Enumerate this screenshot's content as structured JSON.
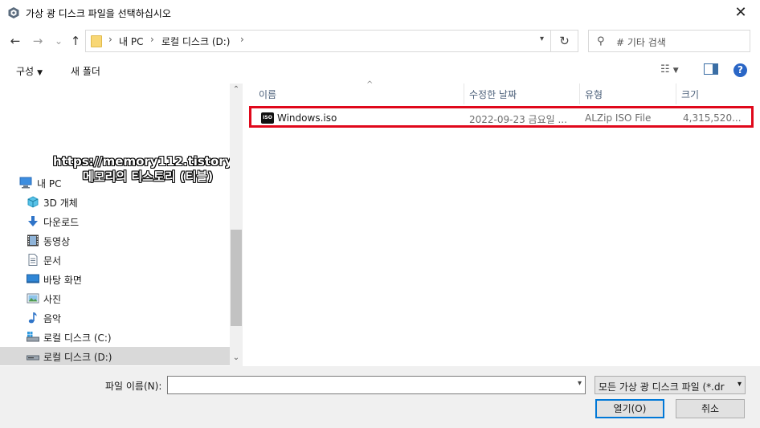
{
  "window": {
    "title": "가상 광 디스크 파일을 선택하십시오",
    "app_icon": "vmware-logo-icon",
    "close_glyph": "✕"
  },
  "nav": {
    "back_glyph": "←",
    "forward_glyph": "→",
    "recent_glyph": "⌄",
    "up_glyph": "↑",
    "breadcrumb": [
      "내 PC",
      "로컬 디스크 (D:)"
    ],
    "separator": "›",
    "refresh_glyph": "↻",
    "search_placeholder": "# 기타 검색"
  },
  "toolbar": {
    "organize_label": "구성",
    "new_folder_label": "새 폴더"
  },
  "watermark": {
    "line1": "https://memory112.tistory.com",
    "line2": "메모리의 티스토리 (티블)"
  },
  "sidebar": {
    "items": [
      {
        "label": "내 PC",
        "icon": "computer-icon"
      },
      {
        "label": "3D 개체",
        "icon": "cube-3d-icon"
      },
      {
        "label": "다운로드",
        "icon": "download-arrow-icon"
      },
      {
        "label": "동영상",
        "icon": "film-icon"
      },
      {
        "label": "문서",
        "icon": "document-icon"
      },
      {
        "label": "바탕 화면",
        "icon": "desktop-icon"
      },
      {
        "label": "사진",
        "icon": "picture-icon"
      },
      {
        "label": "음악",
        "icon": "music-note-icon"
      },
      {
        "label": "로컬 디스크 (C:)",
        "icon": "windows-drive-icon"
      },
      {
        "label": "로컬 디스크 (D:)",
        "icon": "drive-icon",
        "selected": true
      }
    ]
  },
  "columns": {
    "name": "이름",
    "date": "수정한 날짜",
    "type": "유형",
    "size": "크기"
  },
  "files": [
    {
      "name": "Windows.iso",
      "date": "2022-09-23 금요일 ...",
      "type": "ALZip ISO File",
      "size": "4,315,520...",
      "icon_text": "ISO"
    }
  ],
  "bottom": {
    "filename_label": "파일 이름(N):",
    "filename_value": "",
    "filter_value": "모든 가상 광 디스크 파일 (*.dr",
    "open_label": "열기(O)",
    "cancel_label": "취소"
  },
  "colors": {
    "highlight": "#e0081b",
    "accent": "#0078d7"
  }
}
